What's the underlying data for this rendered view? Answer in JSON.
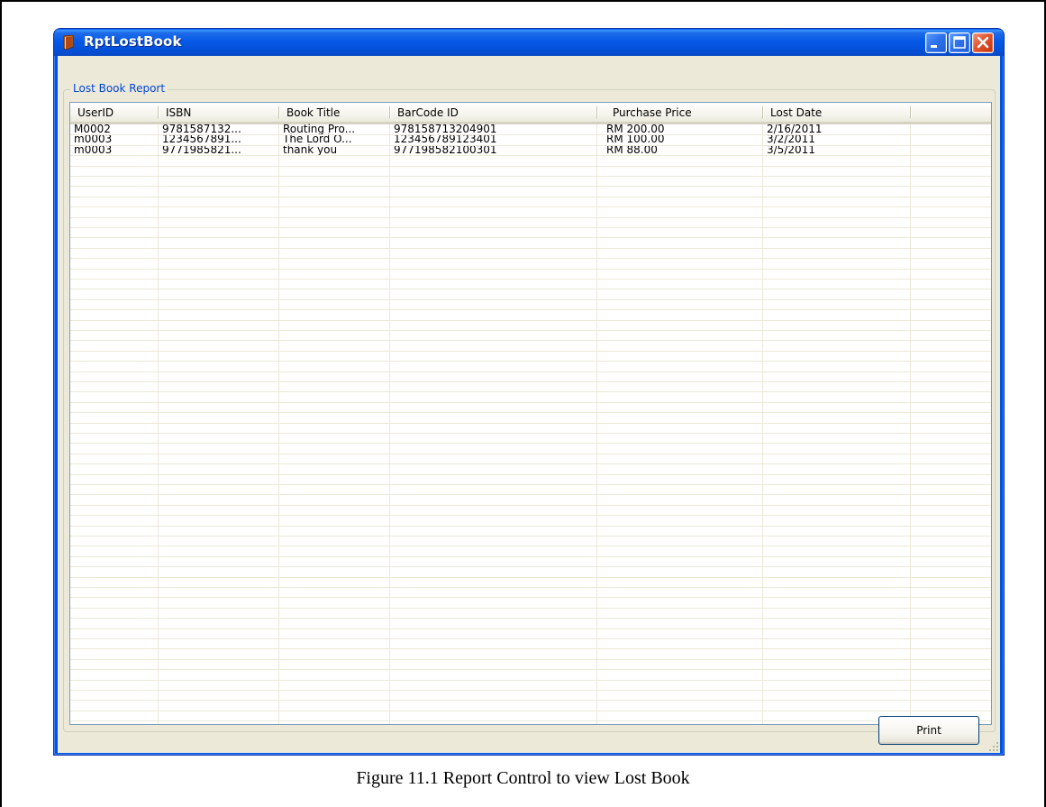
{
  "window": {
    "title": "RptLostBook",
    "icon": "book-app-icon"
  },
  "titlebar_buttons": {
    "minimize": "minimize-icon",
    "maximize": "maximize-icon",
    "close": "close-icon"
  },
  "groupbox": {
    "label": "Lost Book Report"
  },
  "table": {
    "columns": [
      "UserID",
      "ISBN",
      "Book Title",
      "BarCode ID",
      "Purchase Price",
      "Lost Date"
    ],
    "rows": [
      [
        "M0002",
        "9781587132...",
        "Routing Pro...",
        "978158713204901",
        "RM 200.00",
        "2/16/2011"
      ],
      [
        "m0003",
        "1234567891...",
        "The Lord O...",
        "123456789123401",
        "RM 100.00",
        "3/2/2011"
      ],
      [
        "m0003",
        "9771985821...",
        "thank you",
        "977198582100301",
        "RM 88.00",
        "3/5/2011"
      ]
    ]
  },
  "buttons": {
    "print_label": "Print"
  },
  "caption": {
    "text": "Figure 11.1 Report Control to view Lost Book"
  },
  "colors": {
    "titlebar": "#0054e3",
    "group_label": "#0046d5",
    "dialog_bg": "#ece9d8"
  }
}
